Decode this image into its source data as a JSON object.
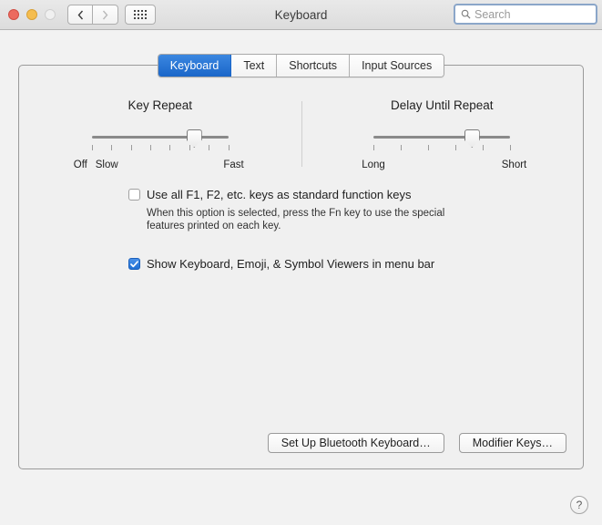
{
  "window": {
    "title": "Keyboard",
    "traffic_lights": [
      {
        "name": "close",
        "color": "#ec6a5f",
        "state": "enabled"
      },
      {
        "name": "minimize",
        "color": "#f5bd4f",
        "state": "enabled"
      },
      {
        "name": "zoom",
        "color": "#f0f0f0",
        "state": "disabled"
      }
    ],
    "nav_back_icon": "chevron-left-icon",
    "nav_forward_icon": "chevron-right-icon",
    "show_all_icon": "grid-dots-icon"
  },
  "search": {
    "placeholder": "Search",
    "value": "",
    "icon": "search-icon",
    "focused": true,
    "focus_ring_color": "#8ba6c9"
  },
  "tabs": [
    {
      "label": "Keyboard",
      "active": true
    },
    {
      "label": "Text",
      "active": false
    },
    {
      "label": "Shortcuts",
      "active": false
    },
    {
      "label": "Input Sources",
      "active": false
    }
  ],
  "sliders": [
    {
      "title": "Key Repeat",
      "left_labels": [
        "Off",
        "Slow"
      ],
      "right_label": "Fast",
      "tick_count": 8,
      "value_percent": 75
    },
    {
      "title": "Delay Until Repeat",
      "left_labels": [
        "Long"
      ],
      "right_label": "Short",
      "tick_count": 6,
      "value_percent": 72
    }
  ],
  "checkboxes": [
    {
      "label": "Use all F1, F2, etc. keys as standard function keys",
      "checked": false,
      "help": "When this option is selected, press the Fn key to use the special features printed on each key."
    },
    {
      "label": "Show Keyboard, Emoji, & Symbol Viewers in menu bar",
      "checked": true,
      "help": ""
    }
  ],
  "buttons": {
    "bluetooth": "Set Up Bluetooth Keyboard…",
    "modifier": "Modifier Keys…",
    "help": "?"
  },
  "colors": {
    "accent": "#1a66c9",
    "window_bg": "#f2f2f2",
    "panel_bg": "#f0f0f0",
    "titlebar_bg": "#e2e2e2"
  }
}
